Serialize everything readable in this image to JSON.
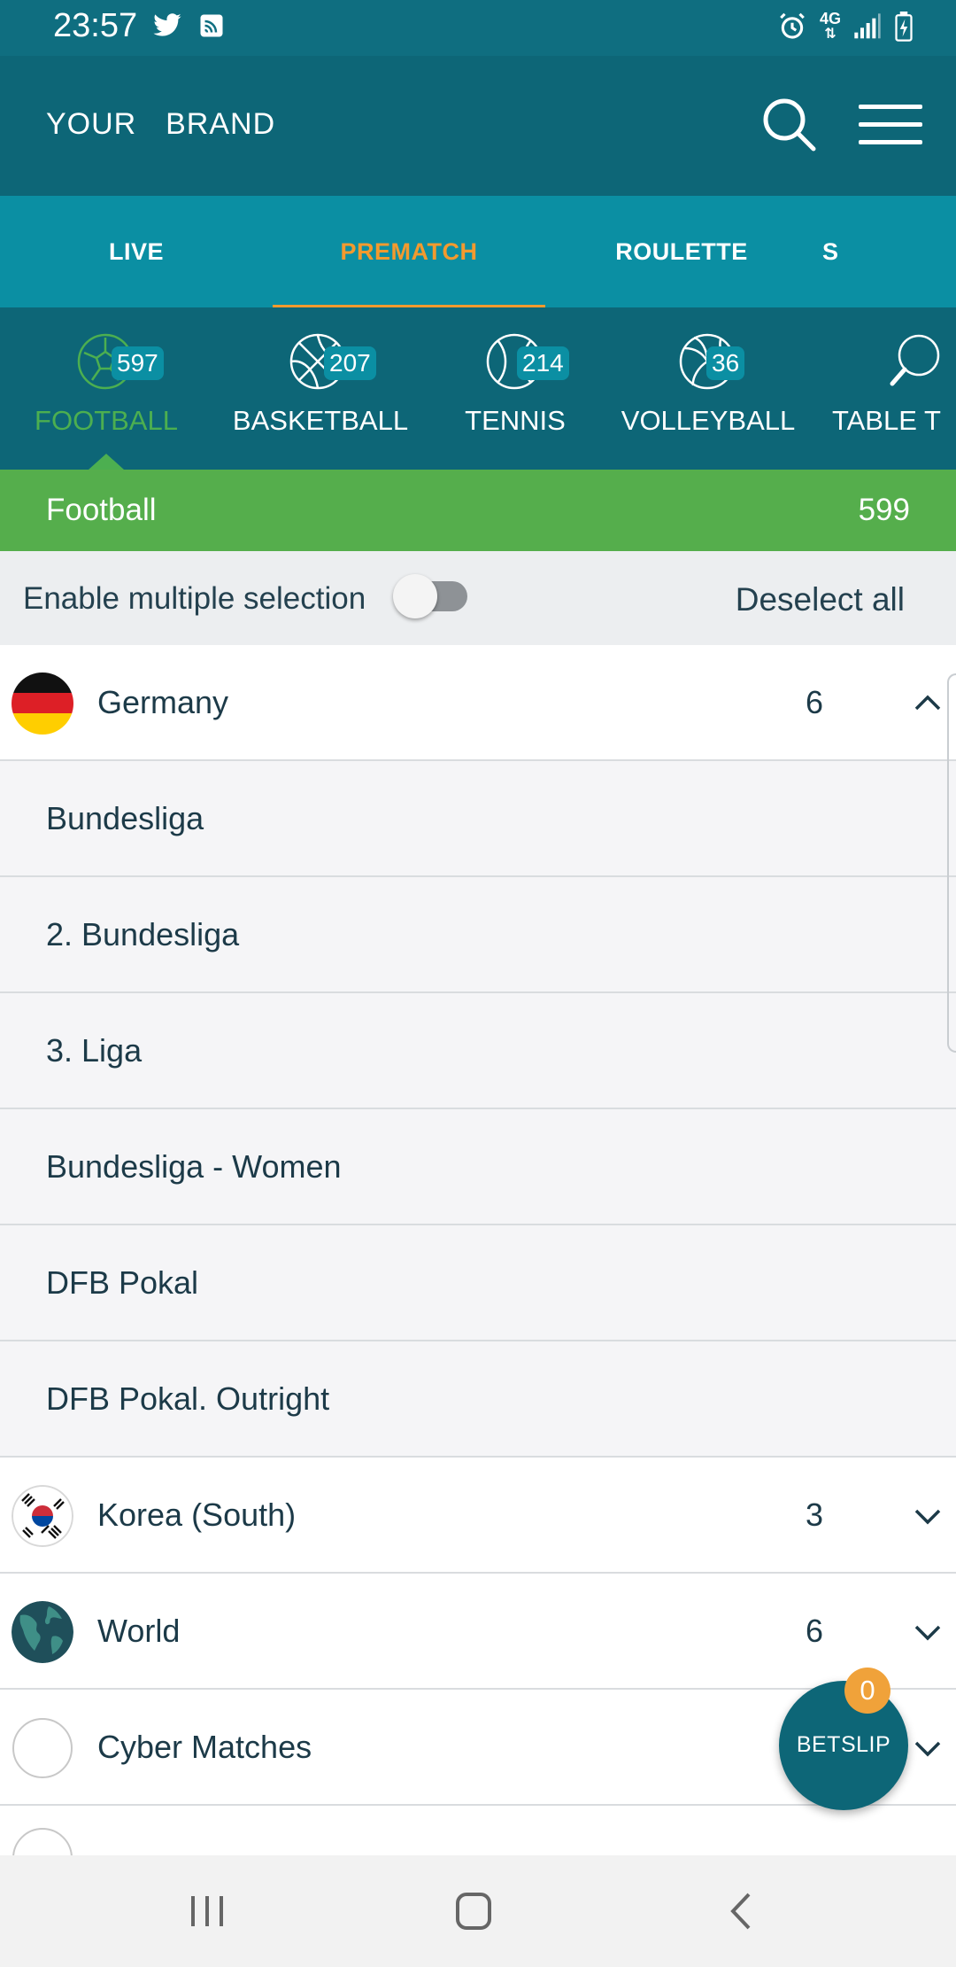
{
  "status_bar": {
    "time": "23:57",
    "left_icons": [
      "twitter-icon",
      "cast-icon"
    ],
    "right_icons": [
      "alarm-icon",
      "4g-icon",
      "signal-icon",
      "battery-icon"
    ],
    "network": "4G"
  },
  "header": {
    "brand": "YOUR  BRAND",
    "search_icon": "search-icon",
    "menu_icon": "hamburger-menu-icon"
  },
  "main_tabs": [
    {
      "label": "LIVE",
      "active": false
    },
    {
      "label": "PREMATCH",
      "active": true
    },
    {
      "label": "ROULETTE",
      "active": false
    },
    {
      "label": "S",
      "active": false
    }
  ],
  "sport_tabs": [
    {
      "label": "FOOTBALL",
      "count": "597",
      "icon": "football-icon",
      "active": true
    },
    {
      "label": "BASKETBALL",
      "count": "207",
      "icon": "basketball-icon",
      "active": false
    },
    {
      "label": "TENNIS",
      "count": "214",
      "icon": "tennis-icon",
      "active": false
    },
    {
      "label": "VOLLEYBALL",
      "count": "36",
      "icon": "volleyball-icon",
      "active": false
    },
    {
      "label": "TABLE T",
      "icon": "table-tennis-icon",
      "active": false
    }
  ],
  "category": {
    "title": "Football",
    "count": "599"
  },
  "options": {
    "multi_selection_label": "Enable multiple selection",
    "multi_selection_enabled": false,
    "deselect_label": "Deselect all"
  },
  "countries": [
    {
      "name": "Germany",
      "count": "6",
      "expanded": true,
      "flag": "germany-flag-icon",
      "leagues": [
        "Bundesliga",
        "2. Bundesliga",
        "3. Liga",
        "Bundesliga - Women",
        "DFB Pokal",
        "DFB Pokal. Outright"
      ]
    },
    {
      "name": "Korea (South)",
      "count": "3",
      "expanded": false,
      "flag": "south-korea-flag-icon",
      "leagues": []
    },
    {
      "name": "World",
      "count": "6",
      "expanded": false,
      "flag": "globe-icon",
      "leagues": []
    },
    {
      "name": "Cyber Matches",
      "count": "",
      "expanded": false,
      "flag": "empty-circle-icon",
      "leagues": []
    }
  ],
  "betslip": {
    "label": "BETSLIP",
    "count": "0"
  },
  "nav_bar": {
    "buttons": [
      "recent-apps-icon",
      "home-icon",
      "back-icon"
    ]
  },
  "colors": {
    "header": "#0d6677",
    "tabs": "#0b8fa3",
    "accent_orange": "#f39a2e",
    "active_green": "#4caf50",
    "category_bar": "#55ae4c"
  }
}
